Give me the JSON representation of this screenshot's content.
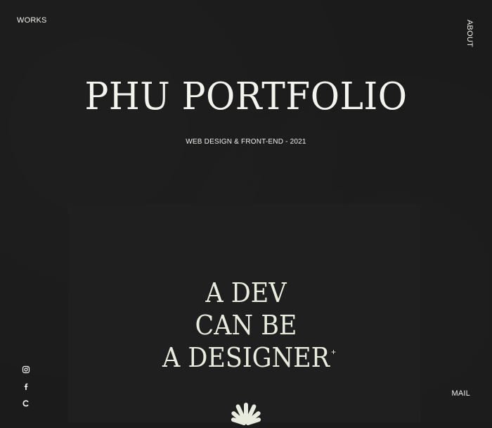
{
  "nav": {
    "works_label": "WORKS",
    "about_label": "ABOUT",
    "mail_label": "MAIL"
  },
  "hero": {
    "title": "PHU PORTFOLIO",
    "subtitle": "WEB DESIGN & FRONT-END - 2021"
  },
  "feature": {
    "lines": [
      "A DEV",
      "CAN BE",
      "A DESIGNER"
    ],
    "mark": "+"
  },
  "social": {
    "icons": [
      "instagram-icon",
      "facebook-icon",
      "codepen-icon"
    ]
  },
  "colors": {
    "background": "#1b1b1b",
    "text": "#f1f1ed",
    "accent_text": "#e7ecdf"
  }
}
